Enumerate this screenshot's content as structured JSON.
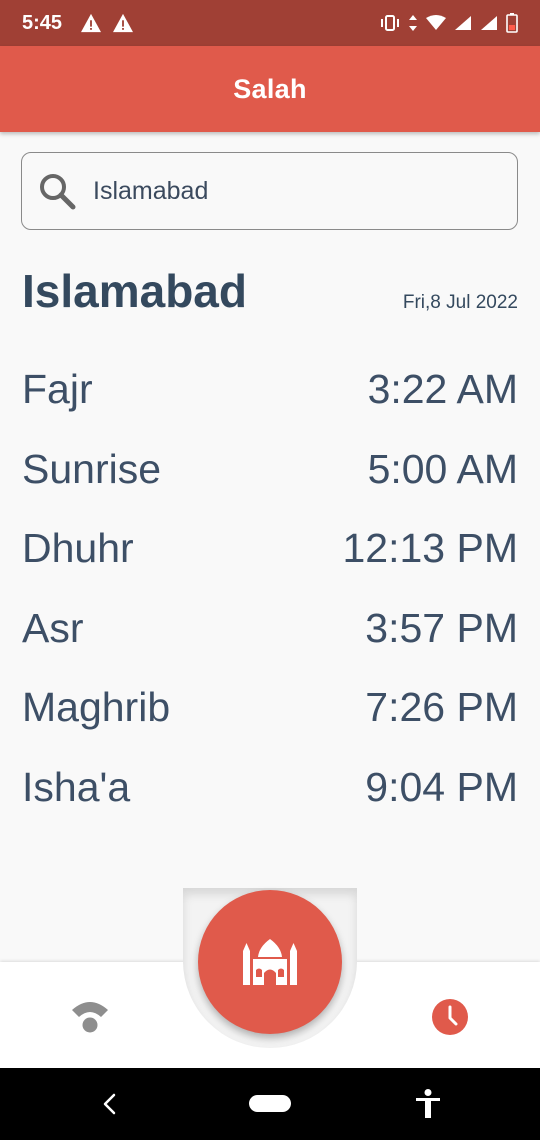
{
  "status_bar": {
    "time": "5:45"
  },
  "app_bar": {
    "title": "Salah"
  },
  "search": {
    "value": "Islamabad"
  },
  "location": {
    "city": "Islamabad",
    "date": "Fri,8 Jul 2022"
  },
  "prayers": [
    {
      "name": "Fajr",
      "time": "3:22 AM"
    },
    {
      "name": "Sunrise",
      "time": "5:00 AM"
    },
    {
      "name": "Dhuhr",
      "time": "12:13 PM"
    },
    {
      "name": "Asr",
      "time": "3:57 PM"
    },
    {
      "name": "Maghrib",
      "time": "7:26 PM"
    },
    {
      "name": "Isha'a",
      "time": "9:04 PM"
    }
  ],
  "bottom_nav": {
    "left_icon": "wifi-icon",
    "center_icon": "mosque-icon",
    "right_icon": "clock-icon"
  },
  "colors": {
    "primary": "#e05a4b",
    "status_bar": "#a04035",
    "text": "#34495e"
  }
}
